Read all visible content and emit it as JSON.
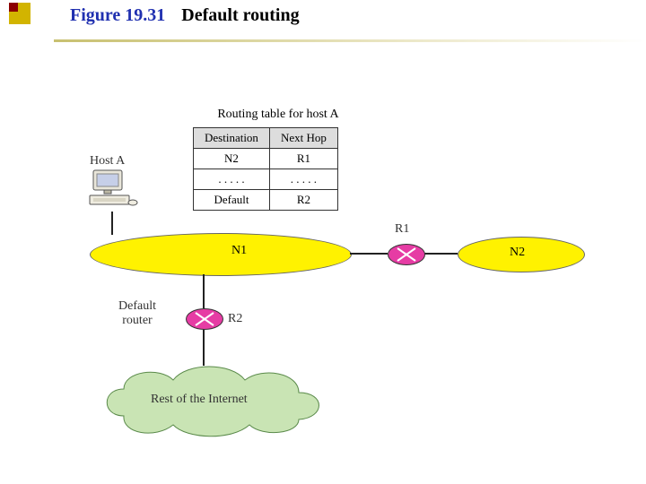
{
  "figure": {
    "number": "Figure 19.31",
    "title": "Default routing"
  },
  "routing_table": {
    "caption": "Routing table for host A",
    "headers": [
      "Destination",
      "Next Hop"
    ],
    "rows": [
      {
        "dest": "N2",
        "hop": "R1"
      },
      {
        "dest": ". . . . .",
        "hop": ". . . . ."
      },
      {
        "dest": "Default",
        "hop": "R2"
      }
    ]
  },
  "nodes": {
    "host_a_label": "Host A",
    "n1": "N1",
    "n2": "N2",
    "r1": "R1",
    "r2": "R2",
    "default_router_label": "Default\nrouter",
    "cloud_label": "Rest of the Internet"
  },
  "icons": {
    "router": "router-cross-icon",
    "computer": "desktop-computer-icon",
    "cloud": "internet-cloud-icon",
    "bullet": "slide-bullet-icon"
  },
  "colors": {
    "net": "#FFF200",
    "router": "#E63CA4",
    "cloud_fill": "#C9E4B4",
    "accent": "#2030B0"
  }
}
